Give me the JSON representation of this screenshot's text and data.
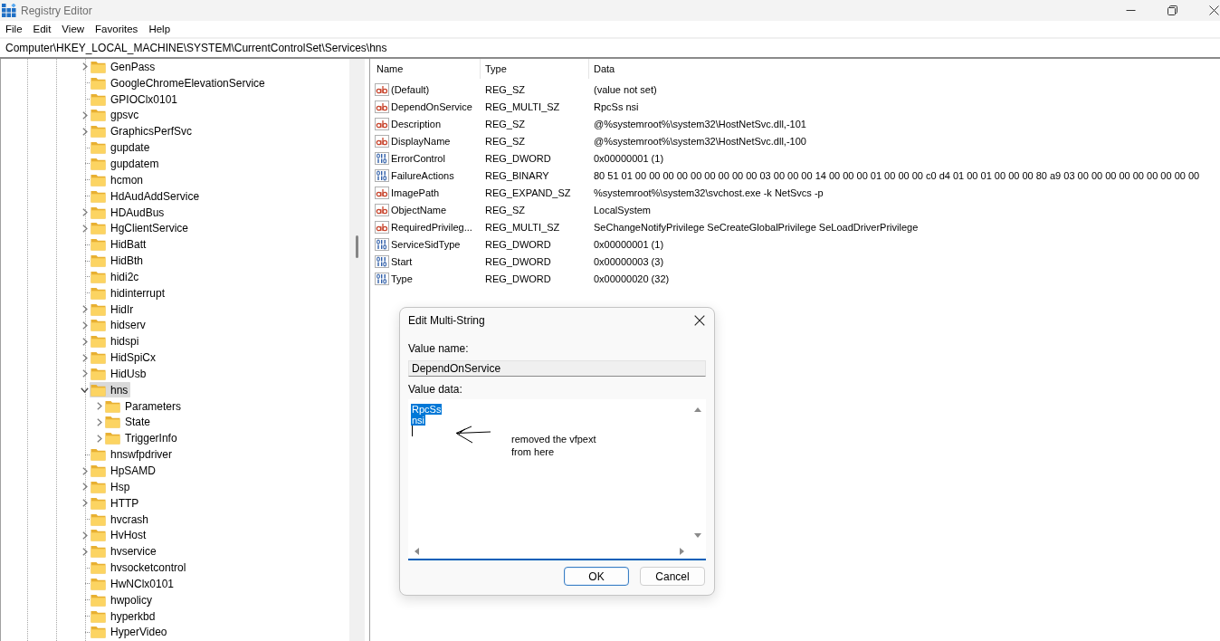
{
  "window": {
    "title": "Registry Editor"
  },
  "menu": [
    "File",
    "Edit",
    "View",
    "Favorites",
    "Help"
  ],
  "address": "Computer\\HKEY_LOCAL_MACHINE\\SYSTEM\\CurrentControlSet\\Services\\hns",
  "tree": {
    "items": [
      {
        "label": "GenPass",
        "expandable": true,
        "expanded": false,
        "selected": false
      },
      {
        "label": "GoogleChromeElevationService",
        "expandable": false,
        "expanded": false,
        "selected": false
      },
      {
        "label": "GPIOClx0101",
        "expandable": false,
        "expanded": false,
        "selected": false
      },
      {
        "label": "gpsvc",
        "expandable": true,
        "expanded": false,
        "selected": false
      },
      {
        "label": "GraphicsPerfSvc",
        "expandable": true,
        "expanded": false,
        "selected": false
      },
      {
        "label": "gupdate",
        "expandable": false,
        "expanded": false,
        "selected": false
      },
      {
        "label": "gupdatem",
        "expandable": false,
        "expanded": false,
        "selected": false
      },
      {
        "label": "hcmon",
        "expandable": false,
        "expanded": false,
        "selected": false
      },
      {
        "label": "HdAudAddService",
        "expandable": false,
        "expanded": false,
        "selected": false
      },
      {
        "label": "HDAudBus",
        "expandable": true,
        "expanded": false,
        "selected": false
      },
      {
        "label": "HgClientService",
        "expandable": true,
        "expanded": false,
        "selected": false
      },
      {
        "label": "HidBatt",
        "expandable": false,
        "expanded": false,
        "selected": false
      },
      {
        "label": "HidBth",
        "expandable": false,
        "expanded": false,
        "selected": false
      },
      {
        "label": "hidi2c",
        "expandable": false,
        "expanded": false,
        "selected": false
      },
      {
        "label": "hidinterrupt",
        "expandable": false,
        "expanded": false,
        "selected": false
      },
      {
        "label": "HidIr",
        "expandable": true,
        "expanded": false,
        "selected": false
      },
      {
        "label": "hidserv",
        "expandable": true,
        "expanded": false,
        "selected": false
      },
      {
        "label": "hidspi",
        "expandable": true,
        "expanded": false,
        "selected": false
      },
      {
        "label": "HidSpiCx",
        "expandable": true,
        "expanded": false,
        "selected": false
      },
      {
        "label": "HidUsb",
        "expandable": true,
        "expanded": false,
        "selected": false
      },
      {
        "label": "hns",
        "expandable": true,
        "expanded": true,
        "selected": true,
        "children": [
          {
            "label": "Parameters",
            "expandable": true,
            "expanded": false,
            "selected": false
          },
          {
            "label": "State",
            "expandable": true,
            "expanded": false,
            "selected": false
          },
          {
            "label": "TriggerInfo",
            "expandable": true,
            "expanded": false,
            "selected": false
          }
        ]
      },
      {
        "label": "hnswfpdriver",
        "expandable": false,
        "expanded": false,
        "selected": false
      },
      {
        "label": "HpSAMD",
        "expandable": true,
        "expanded": false,
        "selected": false
      },
      {
        "label": "Hsp",
        "expandable": true,
        "expanded": false,
        "selected": false
      },
      {
        "label": "HTTP",
        "expandable": true,
        "expanded": false,
        "selected": false
      },
      {
        "label": "hvcrash",
        "expandable": false,
        "expanded": false,
        "selected": false
      },
      {
        "label": "HvHost",
        "expandable": true,
        "expanded": false,
        "selected": false
      },
      {
        "label": "hvservice",
        "expandable": true,
        "expanded": false,
        "selected": false
      },
      {
        "label": "hvsocketcontrol",
        "expandable": false,
        "expanded": false,
        "selected": false
      },
      {
        "label": "HwNClx0101",
        "expandable": false,
        "expanded": false,
        "selected": false
      },
      {
        "label": "hwpolicy",
        "expandable": false,
        "expanded": false,
        "selected": false
      },
      {
        "label": "hyperkbd",
        "expandable": false,
        "expanded": false,
        "selected": false
      },
      {
        "label": "HyperVideo",
        "expandable": false,
        "expanded": false,
        "selected": false
      }
    ]
  },
  "values": {
    "columns": [
      "Name",
      "Type",
      "Data"
    ],
    "rows": [
      {
        "kind": "string",
        "name": "(Default)",
        "type": "REG_SZ",
        "data": "(value not set)"
      },
      {
        "kind": "string",
        "name": "DependOnService",
        "type": "REG_MULTI_SZ",
        "data": "RpcSs nsi"
      },
      {
        "kind": "string",
        "name": "Description",
        "type": "REG_SZ",
        "data": "@%systemroot%\\system32\\HostNetSvc.dll,-101"
      },
      {
        "kind": "string",
        "name": "DisplayName",
        "type": "REG_SZ",
        "data": "@%systemroot%\\system32\\HostNetSvc.dll,-100"
      },
      {
        "kind": "binary",
        "name": "ErrorControl",
        "type": "REG_DWORD",
        "data": "0x00000001 (1)"
      },
      {
        "kind": "binary",
        "name": "FailureActions",
        "type": "REG_BINARY",
        "data": "80 51 01 00 00 00 00 00 00 00 00 00 03 00 00 00 14 00 00 00 01 00 00 00 c0 d4 01 00 01 00 00 00 80 a9 03 00 00 00 00 00 00 00 00 00"
      },
      {
        "kind": "string",
        "name": "ImagePath",
        "type": "REG_EXPAND_SZ",
        "data": "%systemroot%\\system32\\svchost.exe -k NetSvcs -p"
      },
      {
        "kind": "string",
        "name": "ObjectName",
        "type": "REG_SZ",
        "data": "LocalSystem"
      },
      {
        "kind": "string",
        "name": "RequiredPrivileg...",
        "type": "REG_MULTI_SZ",
        "data": "SeChangeNotifyPrivilege SeCreateGlobalPrivilege SeLoadDriverPrivilege"
      },
      {
        "kind": "binary",
        "name": "ServiceSidType",
        "type": "REG_DWORD",
        "data": "0x00000001 (1)"
      },
      {
        "kind": "binary",
        "name": "Start",
        "type": "REG_DWORD",
        "data": "0x00000003 (3)"
      },
      {
        "kind": "binary",
        "name": "Type",
        "type": "REG_DWORD",
        "data": "0x00000020 (32)"
      }
    ]
  },
  "dialog": {
    "title": "Edit Multi-String",
    "value_name_label": "Value name:",
    "value_name": "DependOnService",
    "value_data_label": "Value data:",
    "value_data": [
      {
        "text": "RpcSs",
        "selected": true
      },
      {
        "text": "nsi",
        "selected": true
      }
    ],
    "annotation": [
      "removed the vfpext",
      "from here"
    ],
    "buttons": [
      {
        "label": "OK",
        "default": true
      },
      {
        "label": "Cancel",
        "default": false
      }
    ]
  }
}
